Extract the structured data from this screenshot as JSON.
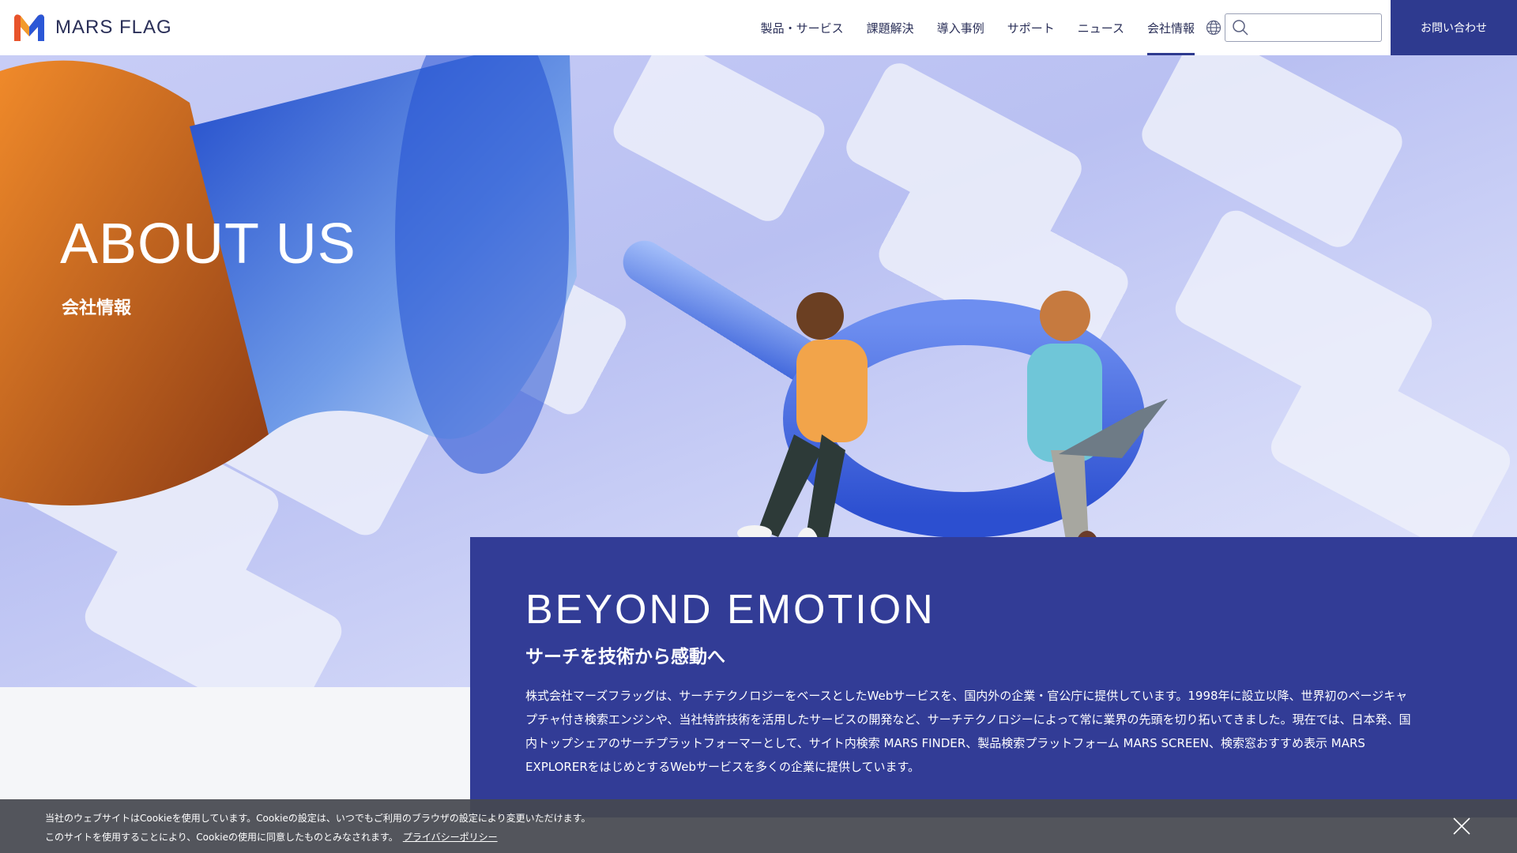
{
  "brand": {
    "name": "MARS FLAG"
  },
  "nav": {
    "items": [
      {
        "label": "製品・サービス"
      },
      {
        "label": "課題解決"
      },
      {
        "label": "導入事例"
      },
      {
        "label": "サポート"
      },
      {
        "label": "ニュース"
      },
      {
        "label": "会社情報",
        "active": true
      }
    ]
  },
  "header": {
    "globe_icon": "globe-icon",
    "search": {
      "placeholder": "",
      "value": "",
      "icon": "search-icon"
    },
    "contact_label": "お問い合わせ"
  },
  "hero": {
    "title": "ABOUT US",
    "subtitle": "会社情報"
  },
  "panel": {
    "title": "BEYOND EMOTION",
    "subtitle": "サーチを技術から感動へ",
    "body": "株式会社マーズフラッグは、サーチテクノロジーをベースとしたWebサービスを、国内外の企業・官公庁に提供しています。1998年に設立以降、世界初のページキャプチャ付き検索エンジンや、当社特許技術を活用したサービスの開発など、サーチテクノロジーによって常に業界の先頭を切り拓いてきました。現在では、日本発、国内トップシェアのサーチプラットフォーマーとして、サイト内検索 MARS FINDER、製品検索プラットフォーム MARS SCREEN、検索窓おすすめ表示 MARS EXPLORERをはじめとするWebサービスを多くの企業に提供しています。"
  },
  "cookie": {
    "line1": "当社のウェブサイトはCookieを使用しています。Cookieの設定は、いつでもご利用のブラウザの設定により変更いただけます。",
    "line2": "このサイトを使用することにより、Cookieの使用に同意したものとみなされます。",
    "privacy_link": "プライバシーポリシー",
    "close_icon": "close-icon"
  },
  "colors": {
    "brand_navy": "#2e3a8f",
    "panel_blue": "#323c96",
    "cookie_bg": "#46484f"
  }
}
